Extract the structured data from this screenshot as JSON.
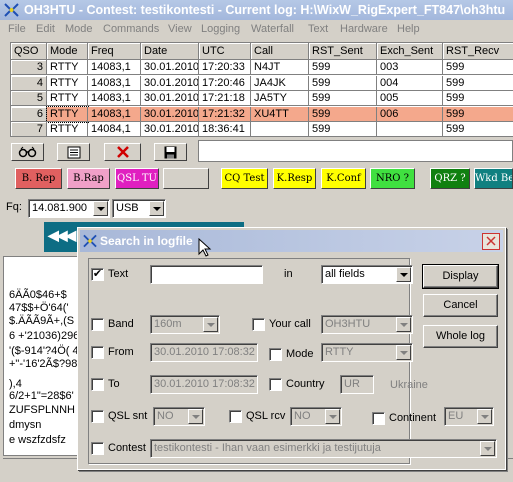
{
  "window": {
    "title": "OH3HTU - Contest: testikontesti - Current log: H:\\WixW_RigExpert_FT847\\oh3htu"
  },
  "menu": [
    "File",
    "Edit",
    "Mode",
    "Commands",
    "View",
    "Logging",
    "Waterfall",
    "Text",
    "Hardware",
    "Help"
  ],
  "grid": {
    "headers": [
      "QSO",
      "Mode",
      "Freq",
      "Date",
      "UTC",
      "Call",
      "RST_Sent",
      "Exch_Sent",
      "RST_Recv"
    ],
    "rows": [
      [
        "3",
        "RTTY",
        "14083,1",
        "30.01.2010",
        "17:20:33",
        "N4JT",
        "599",
        "003",
        "599"
      ],
      [
        "4",
        "RTTY",
        "14083,1",
        "30.01.2010",
        "17:20:46",
        "JA4JK",
        "599",
        "004",
        "599"
      ],
      [
        "5",
        "RTTY",
        "14083,1",
        "30.01.2010",
        "17:21:18",
        "JA5TY",
        "599",
        "005",
        "599"
      ],
      [
        "6",
        "RTTY",
        "14083,1",
        "30.01.2010",
        "17:21:32",
        "XU4TT",
        "599",
        "006",
        "599"
      ],
      [
        "7",
        "RTTY",
        "14084,1",
        "30.01.2010",
        "18:36:41",
        "",
        "599",
        "",
        "599"
      ]
    ],
    "selected_row": 3,
    "highlight_color": "#f4a88c"
  },
  "toolbar_icons": [
    "binoculars-icon",
    "card-icon",
    "delete-icon",
    "save-icon"
  ],
  "macros": [
    {
      "label": "B. Rep",
      "bg": "#e06060",
      "fg": "#000000"
    },
    {
      "label": "B.Rap",
      "bg": "#f0a0c8",
      "fg": "#000000"
    },
    {
      "label": "QSL TU",
      "bg": "#e020c0",
      "fg": "#ffffff"
    },
    {
      "label": "",
      "bg": "#d4d0c8",
      "fg": "#000000"
    },
    {
      "label": "CQ Test",
      "bg": "#ffff00",
      "fg": "#000000"
    },
    {
      "label": "K.Resp",
      "bg": "#ffff00",
      "fg": "#000000"
    },
    {
      "label": "K.Conf",
      "bg": "#ffff00",
      "fg": "#000000"
    },
    {
      "label": "NRO ?",
      "bg": "#40e040",
      "fg": "#000000"
    },
    {
      "label": "QRZ ?",
      "bg": "#108010",
      "fg": "#ffffff"
    },
    {
      "label": "Wkd Be",
      "bg": "#108080",
      "fg": "#ffffff"
    }
  ],
  "freq": {
    "label": "Fq:",
    "value": "14.081.900",
    "mode": "USB"
  },
  "text_pane_lines": [
    "6ÄÃ0$46+$",
    "47$$+Ö'64('",
    "$.ÄÃÃ9Ã+,(S",
    "6 +'21036)296",
    "'($-914'?4Ö( 4",
    "+\"-'16'2Ã$?98",
    "),4",
    "6/2+1\"=28$6'",
    "ZUFSPLNNH",
    "dmysn",
    "e wszfzdsfz"
  ],
  "dialog": {
    "title": "Search in logfile",
    "text_label": "Text",
    "text_value": "",
    "in_label": "in",
    "in_value": "all fields",
    "band_label": "Band",
    "band_value": "160m",
    "yourcall_label": "Your call",
    "yourcall_value": "OH3HTU",
    "from_label": "From",
    "from_value": "30.01.2010 17:08:32",
    "mode_label": "Mode",
    "mode_value": "RTTY",
    "to_label": "To",
    "to_value": "30.01.2010 17:08:32",
    "country_label": "Country",
    "country_value": "UR",
    "country_name": "Ukraine",
    "qslsnt_label": "QSL snt",
    "qslsnt_value": "NO",
    "qslrcv_label": "QSL rcv",
    "qslrcv_value": "NO",
    "continent_label": "Continent",
    "continent_value": "EU",
    "contest_label": "Contest",
    "contest_value": "testikontesti - Ihan vaan esimerkki ja testijutuja",
    "display_btn": "Display",
    "cancel_btn": "Cancel",
    "wholelog_btn": "Whole log",
    "text_checked": true
  }
}
